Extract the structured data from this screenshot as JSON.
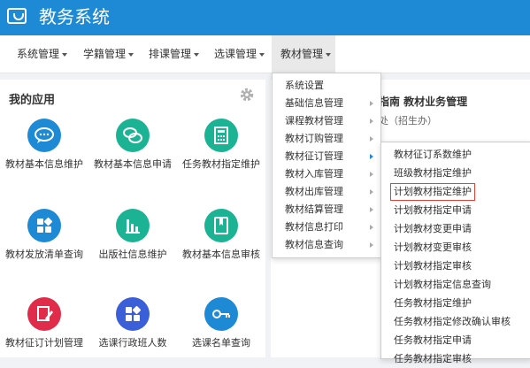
{
  "app": {
    "title": "教务系统"
  },
  "nav": [
    "系统管理",
    "学籍管理",
    "排课管理",
    "选课管理",
    "教材管理"
  ],
  "left_panel": {
    "title": "我的应用",
    "tiles": [
      {
        "label": "教材基本信息维护",
        "color": "#1e8ad6",
        "icon": "chat-bubble-icon"
      },
      {
        "label": "教材基本信息申请",
        "color": "#1bb394",
        "icon": "chat-bubbles-icon"
      },
      {
        "label": "任务教材指定维护",
        "color": "#1bb394",
        "icon": "calculator-icon"
      },
      {
        "label": "教材发放清单查询",
        "color": "#1e8ad6",
        "icon": "grid-icon"
      },
      {
        "label": "出版社信息维护",
        "color": "#1bb394",
        "icon": "bar-chart-icon"
      },
      {
        "label": "教材基本信息审核",
        "color": "#1bb394",
        "icon": "book-icon"
      },
      {
        "label": "教材征订计划管理",
        "color": "#e02b4a",
        "icon": "edit-icon"
      },
      {
        "label": "选课行政班人数",
        "color": "#3a5fd8",
        "icon": "grid-icon"
      },
      {
        "label": "选课名单查询",
        "color": "#1e8ad6",
        "icon": "key-icon"
      }
    ]
  },
  "right_panel": {
    "title": "指南 教材业务管理",
    "subtitle": "处（招生办）"
  },
  "menu_level1": {
    "items": [
      {
        "label": "系统设置",
        "sub": false
      },
      {
        "label": "基础信息管理",
        "sub": true
      },
      {
        "label": "课程教材管理",
        "sub": true
      },
      {
        "label": "教材订购管理",
        "sub": true
      },
      {
        "label": "教材征订管理",
        "sub": true,
        "highlighted": true
      },
      {
        "label": "教材入库管理",
        "sub": true
      },
      {
        "label": "教材出库管理",
        "sub": true
      },
      {
        "label": "教材结算管理",
        "sub": true
      },
      {
        "label": "教材信息打印",
        "sub": true
      },
      {
        "label": "教材信息查询",
        "sub": true
      }
    ]
  },
  "menu_level2": {
    "items": [
      "教材征订系数维护",
      "班级教材指定维护",
      "计划教材指定维护",
      "计划教材指定申请",
      "计划教材变更申请",
      "计划教材变更审核",
      "计划教材指定审核",
      "计划教材指定信息查询",
      "任务教材指定维护",
      "任务教材指定修改确认审核",
      "任务教材指定申请",
      "任务教材指定审核"
    ],
    "selected_index": 2
  },
  "colors": {
    "brand": "#1e8ad6",
    "selected_outline": "#e0433a"
  }
}
